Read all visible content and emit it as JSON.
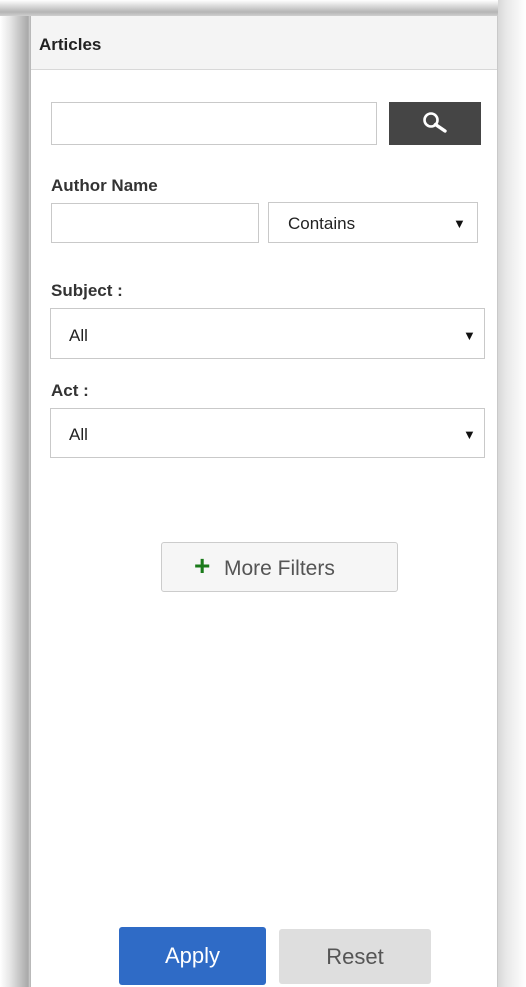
{
  "panel": {
    "title": "Articles"
  },
  "search": {
    "value": "",
    "placeholder": "",
    "icon": "search-icon"
  },
  "author": {
    "label": "Author Name",
    "value": "",
    "match_mode": "Contains"
  },
  "subject": {
    "label": "Subject :",
    "selected": "All"
  },
  "act": {
    "label": "Act :",
    "selected": "All"
  },
  "more_filters": {
    "label": "More Filters"
  },
  "actions": {
    "apply_label": "Apply",
    "reset_label": "Reset"
  },
  "colors": {
    "apply_bg": "#2f6bc6",
    "search_button_bg": "#454545",
    "plus_icon": "#1a7a1a",
    "reset_bg": "#dedede"
  }
}
